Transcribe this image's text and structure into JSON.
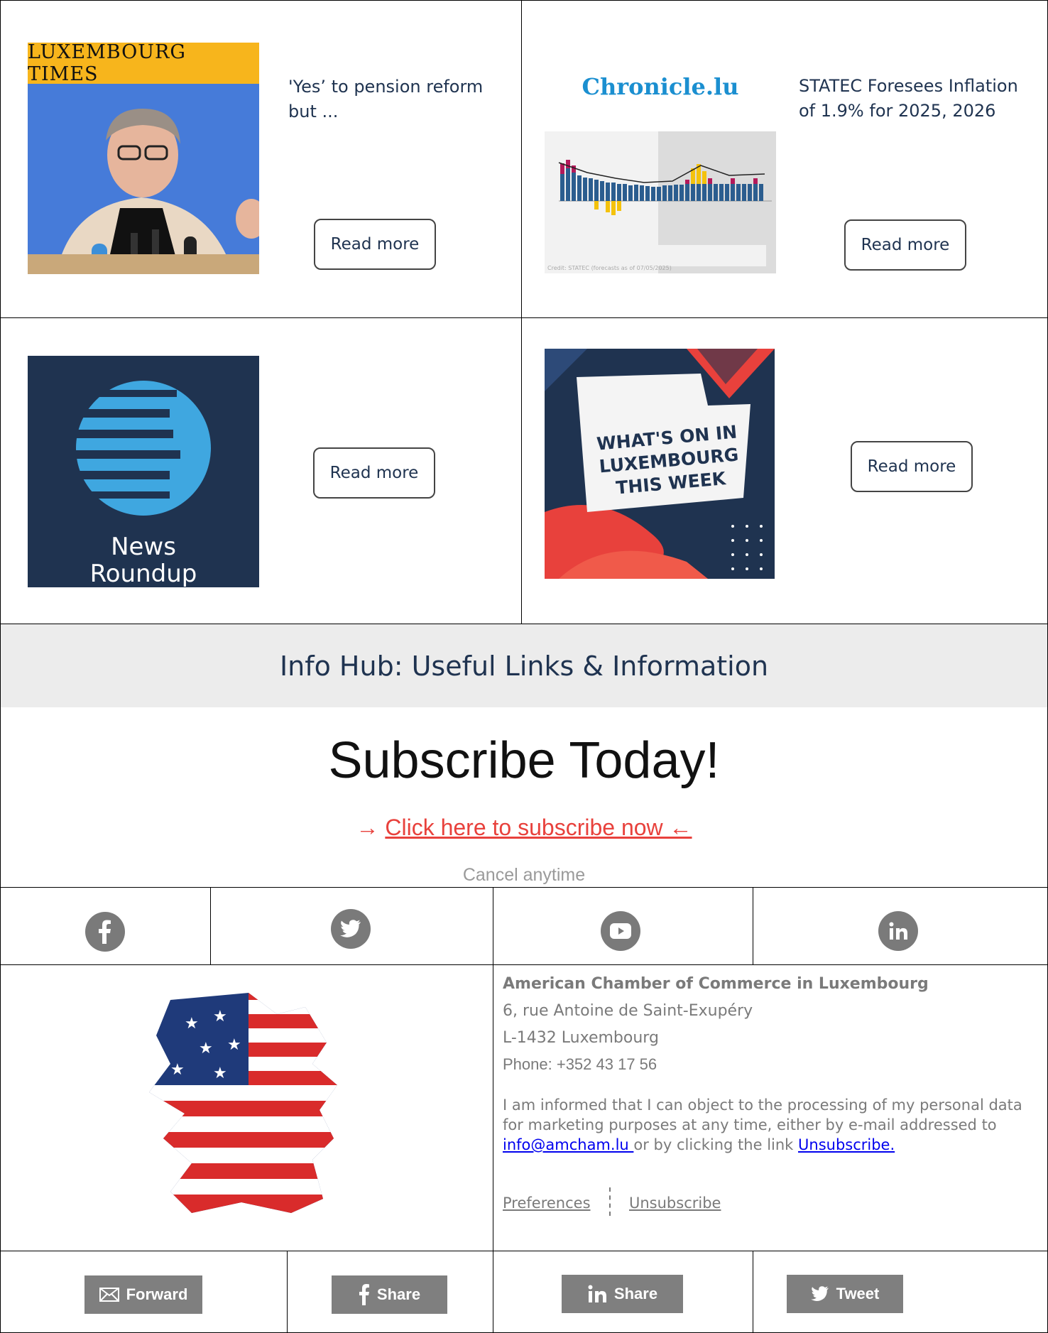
{
  "cards": [
    {
      "source": "LUXEMBOURG TIMES",
      "headline_line1": "'Yes’ to pension reform",
      "headline_line2": "but ...",
      "button": "Read more"
    },
    {
      "source": "Chronicle.lu",
      "headline_line1": "STATEC Foresees Inflation",
      "headline_line2": "of 1.9% for 2025, 2026",
      "button": "Read more",
      "image_credit": "Credit: STATEC (forecasts as of 07/05/2025)"
    },
    {
      "source_line1": "News",
      "source_line2": "Roundup",
      "button": "Read more"
    },
    {
      "image_line1": "WHAT'S ON IN",
      "image_line2": "LUXEMBOURG",
      "image_line3": "THIS WEEK",
      "button": "Read more"
    }
  ],
  "info_hub": {
    "title": "Info Hub: Useful Links & Information"
  },
  "subscribe": {
    "title": "Subscribe Today!",
    "arrow_left": "→",
    "link": "Click here to subscribe now ←",
    "note": "Cancel anytime"
  },
  "social": [
    {
      "name": "facebook-icon"
    },
    {
      "name": "twitter-icon"
    },
    {
      "name": "youtube-icon"
    },
    {
      "name": "linkedin-icon"
    }
  ],
  "footer": {
    "org": "American Chamber of Commerce in Luxembourg",
    "street": "6, rue Antoine de Saint-Exupéry",
    "city": "L-1432 Luxembourg",
    "phone": "Phone: +352 43 17 56",
    "legal_text": "I am informed that I can object to the processing of my personal data for marketing purposes at any time, either by e-mail addressed to ",
    "email": "info@amcham.lu ",
    "legal_mid": "or by clicking the link ",
    "unsub_link": "Unsubscribe.",
    "preferences": "Preferences",
    "unsubscribe": "Unsubscribe"
  },
  "share_bar": {
    "forward": "Forward",
    "share_facebook": "Share",
    "share_linkedin": "Share",
    "tweet": "Tweet"
  },
  "colors": {
    "navy": "#1f3350",
    "accent_red": "#e8413c",
    "grey": "#7f7f7f",
    "hub_bg": "#ececec"
  }
}
